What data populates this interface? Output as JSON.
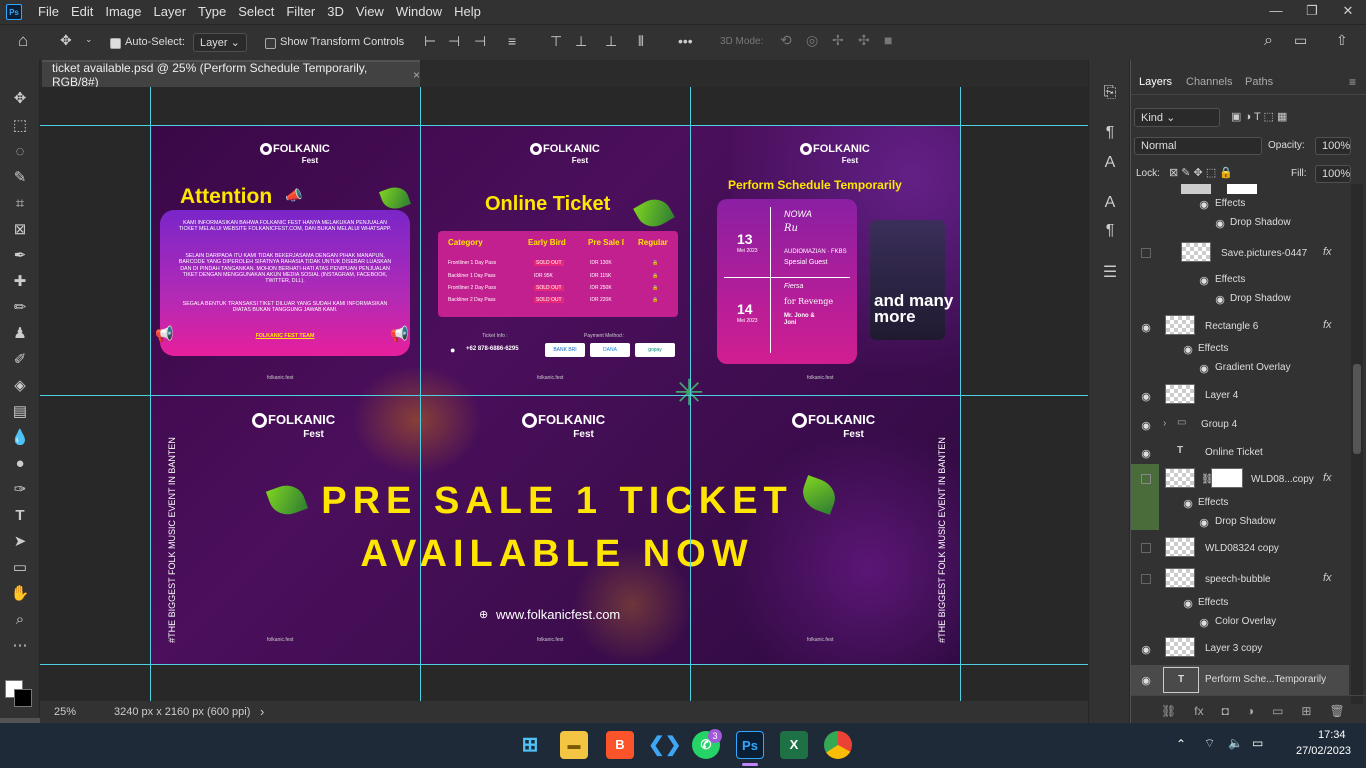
{
  "app": {
    "logo": "Ps"
  },
  "menu": [
    "File",
    "Edit",
    "Image",
    "Layer",
    "Type",
    "Select",
    "Filter",
    "3D",
    "View",
    "Window",
    "Help"
  ],
  "options": {
    "auto_select_label": "Auto-Select:",
    "auto_select_value": "Layer",
    "transform_controls_label": "Show Transform Controls",
    "mode_3d_label": "3D Mode:",
    "more": "•••"
  },
  "document": {
    "tab_title": "ticket available.psd @ 25% (Perform Schedule Temporarily, RGB/8#)",
    "close": "×"
  },
  "artwork": {
    "logo_top": "FOLKANIC",
    "logo_bottom": "Fest",
    "attention_title": "Attention",
    "attention_p1": "KAMI INFORMASIKAN BAHWA FOLKANIC FEST HANYA MELAKUKAN PENJUALAN TICKET MELALUI WEBSITE FOLKANICFEST.COM, DAN BUKAN MELALUI WHATSAPP.",
    "attention_p2": "SELAIN DARIPADA ITU KAMI TIDAK BEKERJASAMA DENGAN PIHAK MANAPUN, BARCODE YANG DIPEROLEH SIFATNYA RAHASIA TIDAK UNTUK DISEBAR LUASKAN DAN DI PINDAH TANGANKAN. MOHON BERHATI-HATI ATAS PENIPUAN PENJUALAN TIKET DENGAN MENGGUNAKAN AKUN MEDIA SOSIAL (INSTAGRAM, FACEBOOK, TWITTER, DLL).",
    "attention_p3": "SEGALA BENTUK TRANSAKSI TIKET DILUAR YANG SUDAH KAMI INFORMASIKAN DIATAS BUKAN TANGGUNG JAWAB KAMI.",
    "attention_sign": "FOLKANIC FEST TEAM",
    "footer": "folkanic.fest",
    "online_ticket_title": "Online Ticket",
    "table_headers": [
      "Category",
      "Early Bird",
      "Pre Sale I",
      "Regular"
    ],
    "table_rows": [
      {
        "cat": "Frontliner 1 Day Pass",
        "early": "SOLD OUT",
        "pre": "IDR 130K",
        "reg": "🔒"
      },
      {
        "cat": "Backliner 1 Day Pass",
        "early": "IDR 95K",
        "pre": "IDR 115K",
        "reg": "🔒"
      },
      {
        "cat": "Frontliner 2 Day Pass",
        "early": "SOLD OUT",
        "pre": "IDR 250K",
        "reg": "🔒"
      },
      {
        "cat": "Backliner 2 Day Pass",
        "early": "SOLD OUT",
        "pre": "IDR 220K",
        "reg": "🔒"
      }
    ],
    "ticket_info_label": "Ticket Info :",
    "ticket_info_phone": "+62 878-6886-6295",
    "payment_label": "Payment Method :",
    "payments": [
      "BANK BRI",
      "DANA",
      "gopay"
    ],
    "schedule_title": "Perform Schedule Temporarily",
    "date1_day": "13",
    "date1_month": "Mei 2023",
    "date2_day": "14",
    "date2_month": "Mei 2023",
    "special_guest": "Spesial Guest",
    "for_revenge": "for Revenge",
    "mejono": "Mr. Jono & Joni",
    "and_many_more": "and many more",
    "side_text": "#THE BIGGEST FOLK MUSIC EVENT IN BANTEN",
    "presale_line1": "PRE SALE 1 TICKET",
    "presale_line2": "AVAILABLE NOW",
    "website": "www.folkanicfest.com"
  },
  "status": {
    "zoom": "25%",
    "info": "3240 px x 2160 px (600 ppi)",
    "arrow": "›"
  },
  "layers_panel": {
    "tabs": [
      "Layers",
      "Channels",
      "Paths"
    ],
    "kind": "Kind",
    "blend": "Normal",
    "opacity_label": "Opacity:",
    "opacity": "100%",
    "lock_label": "Lock:",
    "fill_label": "Fill:",
    "fill": "100%",
    "rows": [
      {
        "name": "Effects"
      },
      {
        "name": "Drop Shadow"
      },
      {
        "name": "Save.pictures-0447"
      },
      {
        "name": "Effects"
      },
      {
        "name": "Drop Shadow"
      },
      {
        "name": "Rectangle 6"
      },
      {
        "name": "Effects"
      },
      {
        "name": "Gradient Overlay"
      },
      {
        "name": "Layer 4"
      },
      {
        "name": "Group 4"
      },
      {
        "name": "Online Ticket"
      },
      {
        "name": "WLD08...copy"
      },
      {
        "name": "Effects"
      },
      {
        "name": "Drop Shadow"
      },
      {
        "name": "WLD08324 copy"
      },
      {
        "name": "speech-bubble"
      },
      {
        "name": "Effects"
      },
      {
        "name": "Color Overlay"
      },
      {
        "name": "Layer 3 copy"
      },
      {
        "name": "Perform Sche...Temporarily"
      }
    ]
  },
  "taskbar": {
    "time": "17:34",
    "date": "27/02/2023",
    "whatsapp_badge": "3"
  }
}
